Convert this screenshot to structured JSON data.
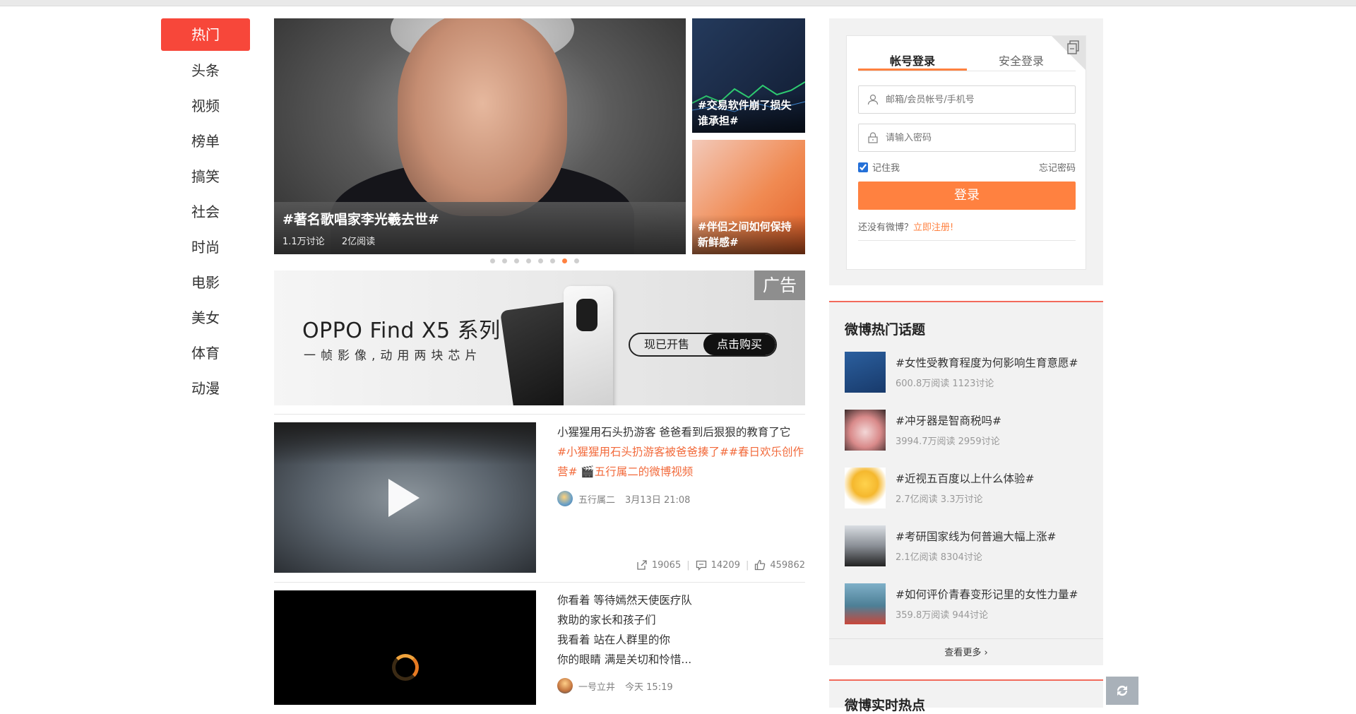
{
  "nav": {
    "items": [
      "热门",
      "头条",
      "视频",
      "榜单",
      "搞笑",
      "社会",
      "时尚",
      "电影",
      "美女",
      "体育",
      "动漫"
    ],
    "active_index": 0,
    "accent_color": "#f7473a"
  },
  "carousel": {
    "main": {
      "title": "#著名歌唱家李光羲去世#",
      "discussions": "1.1万讨论",
      "reads": "2亿阅读"
    },
    "side": [
      {
        "title": "#交易软件崩了损失谁承担#"
      },
      {
        "title": "#伴侣之间如何保持新鲜感#"
      }
    ],
    "dots": 8,
    "active_dot": 6
  },
  "ad": {
    "brand": "OPPO Find X5 系列",
    "slogan": "一帧影像,动用两块芯片",
    "tag": "广告",
    "cta_left": "现已开售",
    "cta_right": "点击购买"
  },
  "feed": [
    {
      "text": "小猩猩用石头扔游客 爸爸看到后狠狠的教育了它",
      "tags": "#小猩猩用石头扔游客被爸爸揍了##春日欢乐创作营# 🎬五行属二的微博视频",
      "author": "五行属二",
      "time": "3月13日 21:08",
      "reposts": "19065",
      "comments": "14209",
      "likes": "459862"
    },
    {
      "lines": [
        "你看着 等待嫣然天使医疗队",
        "救助的家长和孩子们",
        "我看着 站在人群里的你",
        "你的眼睛 满是关切和怜惜..."
      ],
      "author": "一号立井",
      "time": "今天 15:19"
    }
  ],
  "login": {
    "tabs": [
      "帐号登录",
      "安全登录"
    ],
    "username_placeholder": "邮箱/会员帐号/手机号",
    "password_placeholder": "请输入密码",
    "remember": "记住我",
    "forgot": "忘记密码",
    "button": "登录",
    "no_account": "还没有微博？",
    "register": "立即注册!"
  },
  "hot_topics": {
    "title": "微博热门话题",
    "items": [
      {
        "title": "#女性受教育程度为何影响生育意愿#",
        "stats": "600.8万阅读 1123讨论"
      },
      {
        "title": "#冲牙器是智商税吗#",
        "stats": "3994.7万阅读 2959讨论"
      },
      {
        "title": "#近视五百度以上什么体验#",
        "stats": "2.7亿阅读 3.3万讨论"
      },
      {
        "title": "#考研国家线为何普遍大幅上涨#",
        "stats": "2.1亿阅读 8304讨论"
      },
      {
        "title": "#如何评价青春变形记里的女性力量#",
        "stats": "359.8万阅读 944讨论"
      }
    ],
    "more": "查看更多 ›"
  },
  "realtime": {
    "title": "微博实时热点"
  }
}
